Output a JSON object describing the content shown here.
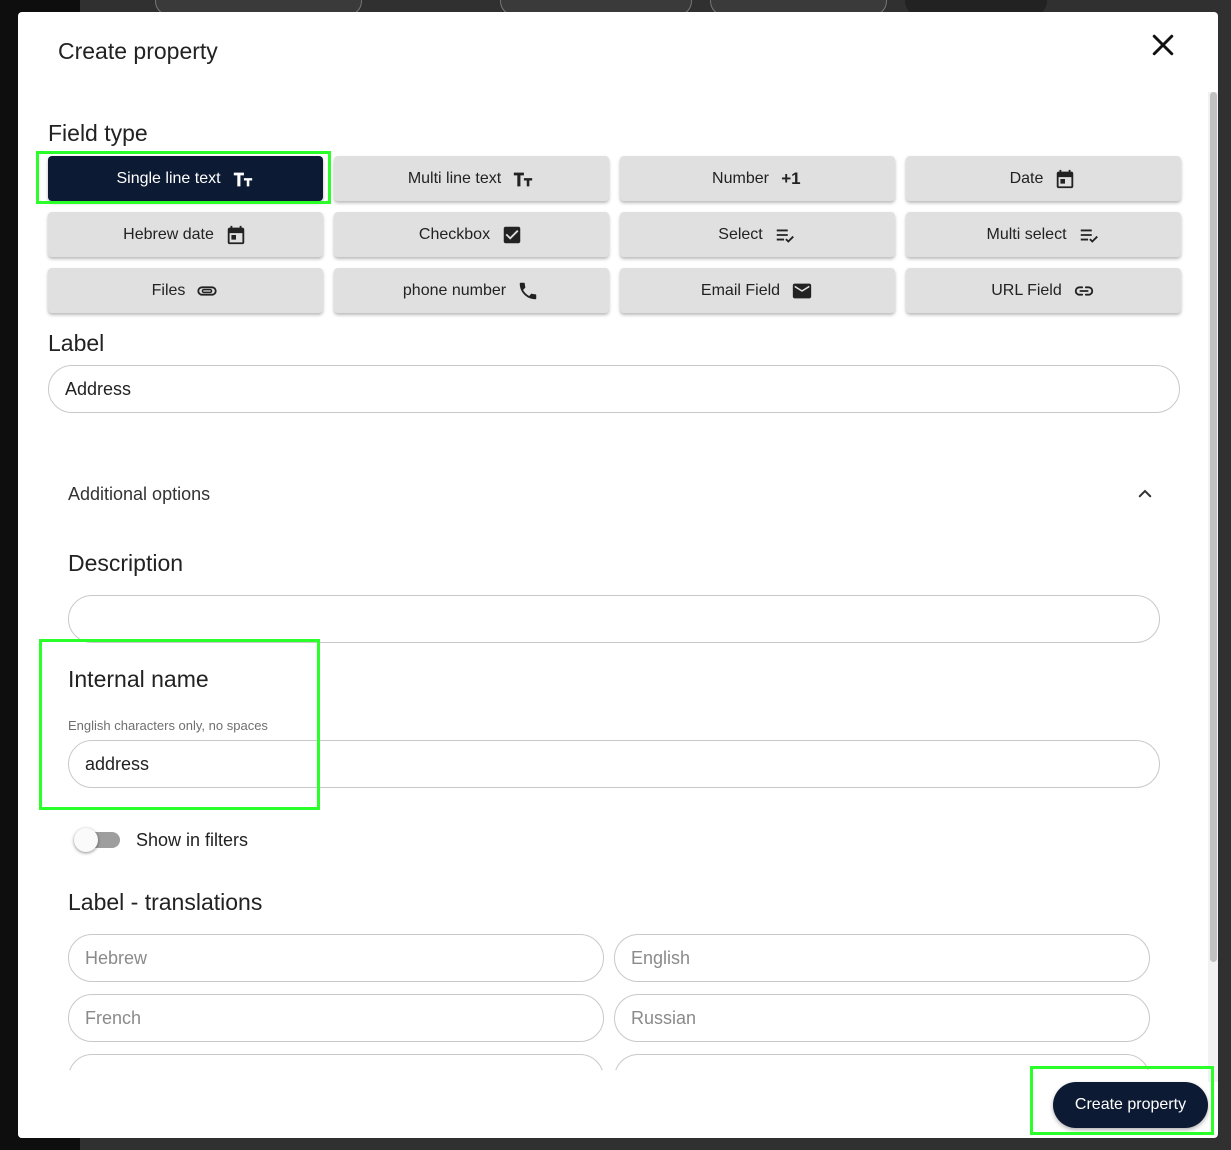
{
  "modal": {
    "title": "Create property"
  },
  "field_type": {
    "label": "Field type",
    "options": [
      {
        "label": "Single line text",
        "icon": "format-size-icon",
        "selected": true
      },
      {
        "label": "Multi line text",
        "icon": "format-size-icon",
        "selected": false
      },
      {
        "label": "Number",
        "icon": "plus-one-icon",
        "selected": false
      },
      {
        "label": "Date",
        "icon": "calendar-icon",
        "selected": false
      },
      {
        "label": "Hebrew date",
        "icon": "calendar-icon",
        "selected": false
      },
      {
        "label": "Checkbox",
        "icon": "checkbox-icon",
        "selected": false
      },
      {
        "label": "Select",
        "icon": "list-check-icon",
        "selected": false
      },
      {
        "label": "Multi select",
        "icon": "list-check-icon",
        "selected": false
      },
      {
        "label": "Files",
        "icon": "paperclip-icon",
        "selected": false
      },
      {
        "label": "phone number",
        "icon": "phone-icon",
        "selected": false
      },
      {
        "label": "Email Field",
        "icon": "email-icon",
        "selected": false
      },
      {
        "label": "URL Field",
        "icon": "link-icon",
        "selected": false
      }
    ],
    "plus_one_text": "+1"
  },
  "label_field": {
    "label": "Label",
    "value": "Address"
  },
  "additional_options": {
    "title": "Additional options",
    "expanded": true,
    "description": {
      "label": "Description",
      "value": ""
    },
    "internal_name": {
      "label": "Internal name",
      "helper": "English characters only, no spaces",
      "value": "address"
    },
    "show_in_filters": {
      "label": "Show in filters",
      "checked": false
    },
    "translations": {
      "label": "Label - translations",
      "fields": [
        {
          "placeholder": "Hebrew",
          "value": ""
        },
        {
          "placeholder": "English",
          "value": ""
        },
        {
          "placeholder": "French",
          "value": ""
        },
        {
          "placeholder": "Russian",
          "value": ""
        }
      ]
    }
  },
  "footer": {
    "create_label": "Create property"
  },
  "colors": {
    "primary": "#0c1a33",
    "button_bg": "#e0e0e0",
    "highlight": "#2aff2a"
  }
}
